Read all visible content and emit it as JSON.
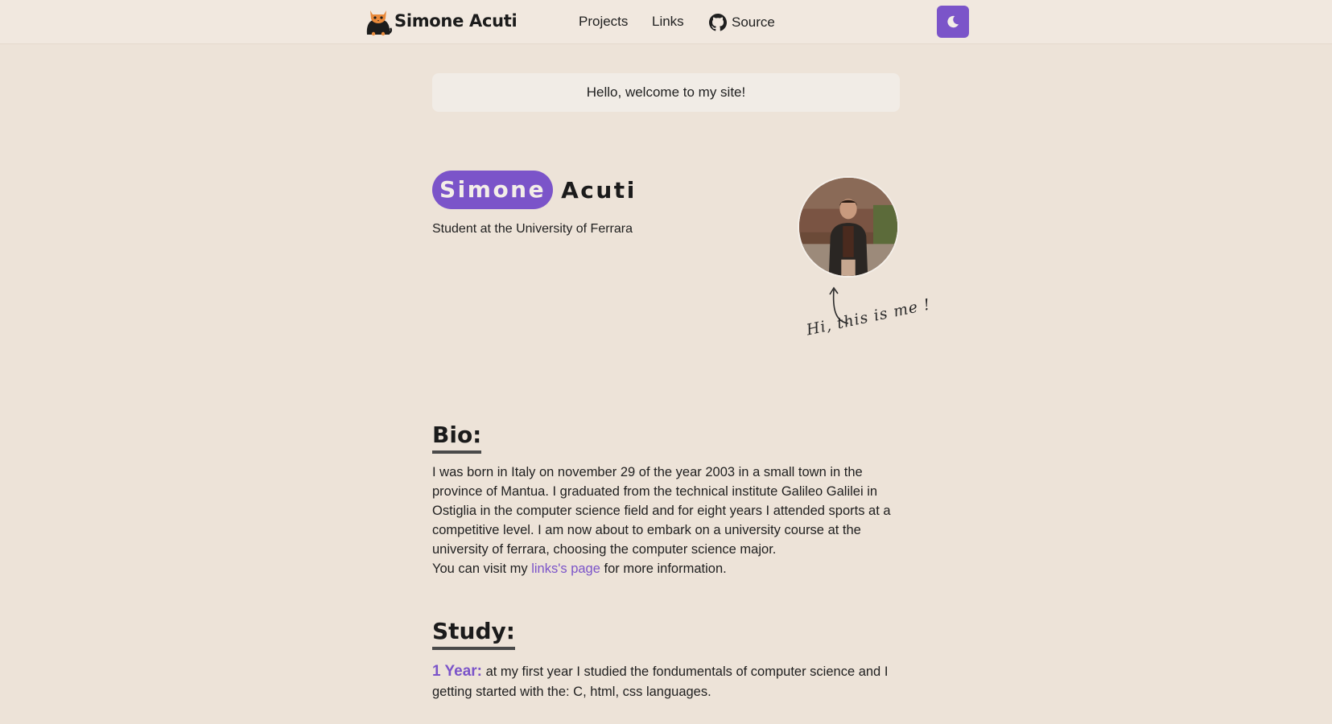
{
  "nav": {
    "brand": "Simone Acuti",
    "links": {
      "projects": "Projects",
      "links": "Links",
      "source": "Source"
    },
    "icons": {
      "logo": "cat-logo-icon",
      "source": "github-icon",
      "theme": "moon-icon"
    }
  },
  "welcome": "Hello, welcome to my site!",
  "hero": {
    "first_name": "Simone",
    "last_name": "Acuti",
    "subtitle": "Student at the University of Ferrara",
    "avatar_note": "Hi, this is me !"
  },
  "bio": {
    "title": "Bio:",
    "paragraph": "I was born in Italy on november 29 of the year 2003 in a small town in the province of Mantua. I graduated from the technical institute Galileo Galilei in Ostiglia in the computer science field and for eight years I attended sports at a competitive level. I am now about to embark on a university course at the university of ferrara, choosing the computer science major.",
    "visit_prefix": "You can visit my ",
    "visit_link": "links's page",
    "visit_suffix": " for more information."
  },
  "study": {
    "title": "Study:",
    "year_label": "1 Year:",
    "year_text": " at my first year I studied the fondumentals of computer science and I getting started with the: C, html, css languages."
  },
  "colors": {
    "accent": "#7b54c9",
    "background": "#ede3d8",
    "nav_background": "#f1e8df"
  }
}
